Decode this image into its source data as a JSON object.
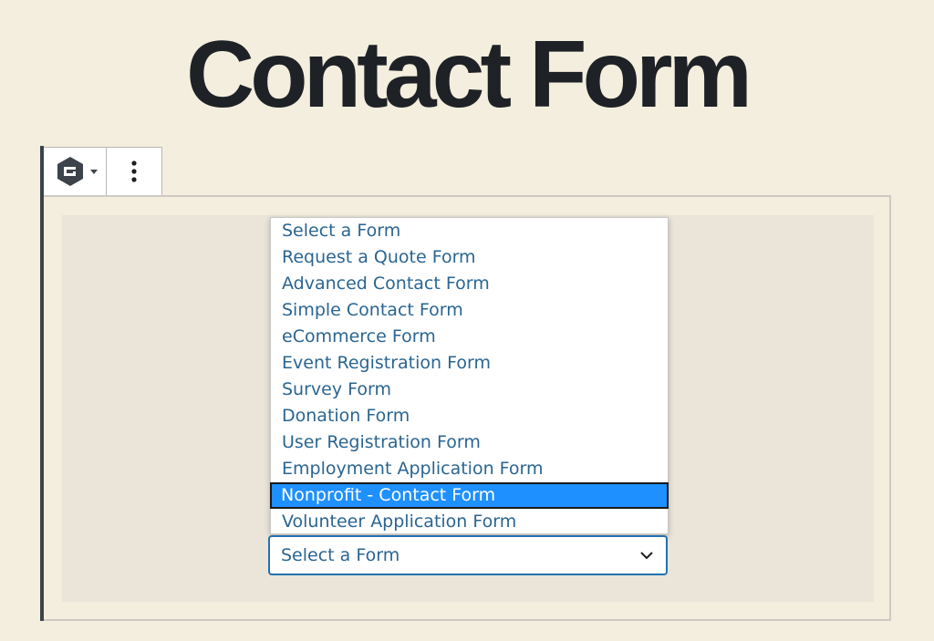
{
  "page": {
    "title": "Contact Form"
  },
  "toolbar": {
    "block_icon": "gravity-forms-logo-icon",
    "switcher_caret_icon": "caret-down-icon",
    "more_icon": "vertical-ellipsis-icon"
  },
  "form_select": {
    "selected_value": "Select a Form",
    "chevron_icon": "chevron-down-icon",
    "options": [
      "Select a Form",
      "Request a Quote Form",
      "Advanced Contact Form",
      "Simple Contact Form",
      "eCommerce Form",
      "Event Registration Form",
      "Survey Form",
      "Donation Form",
      "User Registration Form",
      "Employment Application Form",
      "Nonprofit - Contact Form",
      "Volunteer Application Form"
    ],
    "highlighted_option": "Nonprofit - Contact Form"
  },
  "colors": {
    "background": "#f4eede",
    "title": "#1e2226",
    "option_text": "#2a6591",
    "highlight": "#1e90ff",
    "select_border": "#2271b1"
  }
}
